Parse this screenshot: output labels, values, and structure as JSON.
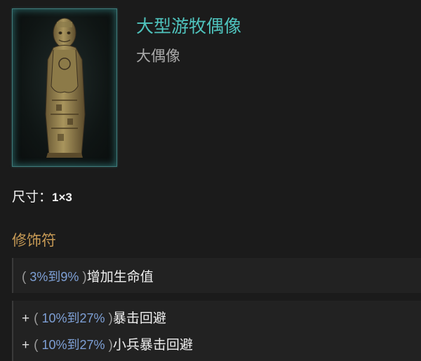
{
  "item": {
    "name": "大型游牧偶像",
    "base_type": "大偶像",
    "name_color": "#4fc3bd",
    "base_color": "#a9a9a9",
    "icon": "idol-statue-icon"
  },
  "size": {
    "label": "尺寸：",
    "value": "1×3"
  },
  "modifiers": {
    "section_title": "修饰符",
    "section_color": "#c79a55",
    "implicit": {
      "open_paren": "(",
      "range": " 3%到9% ",
      "close_paren": ")",
      "text": "增加生命值"
    },
    "affixes": [
      {
        "prefix": "+",
        "open_paren": "(",
        "range": " 10%到27% ",
        "close_paren": ")",
        "text": "暴击回避"
      },
      {
        "prefix": "+",
        "open_paren": "(",
        "range": " 10%到27% ",
        "close_paren": ")",
        "text": "小兵暴击回避"
      }
    ],
    "range_color": "#7ea0d6"
  }
}
